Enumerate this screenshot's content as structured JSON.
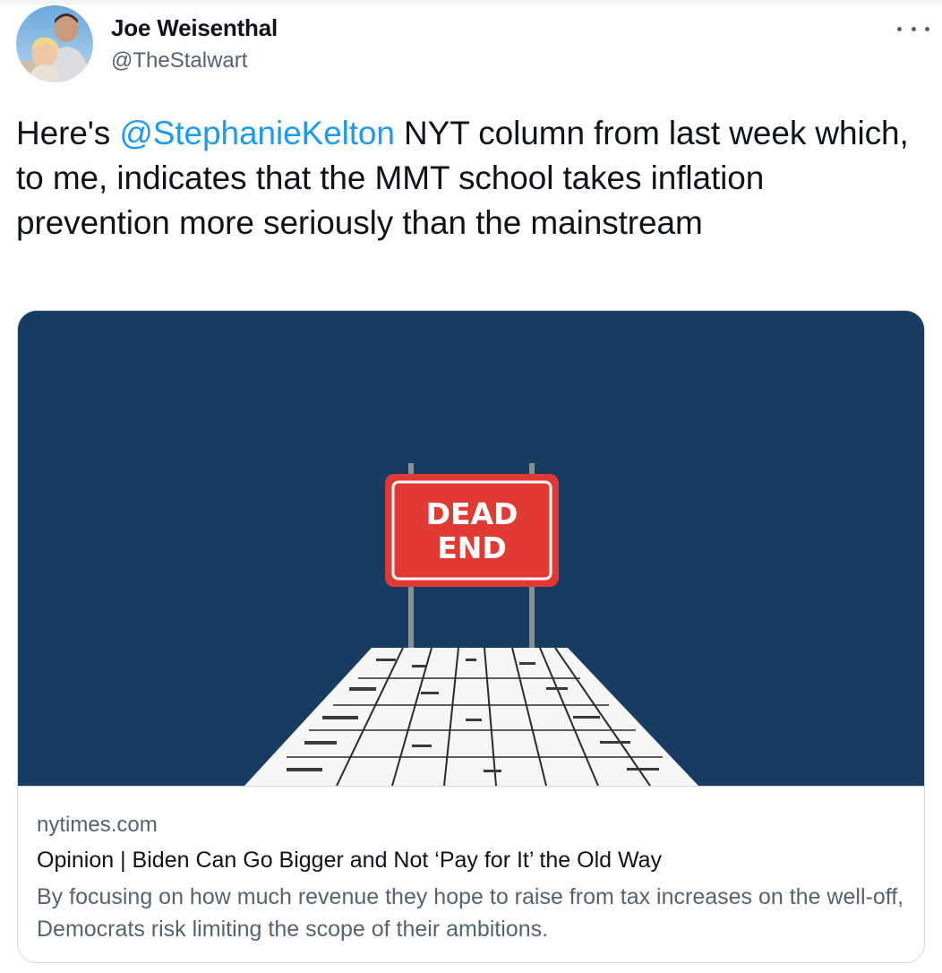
{
  "tweet": {
    "author": {
      "name": "Joe Weisenthal",
      "handle": "@TheStalwart"
    },
    "text": {
      "prefix": "Here's ",
      "mention": "@StephanieKelton",
      "suffix": " NYT column from last week which, to me, indicates that the MMT school takes inflation prevention more seriously than the mainstream"
    }
  },
  "card": {
    "image": {
      "sign_line1": "DEAD",
      "sign_line2": "END"
    },
    "domain": "nytimes.com",
    "title": "Opinion | Biden Can Go Bigger and Not ‘Pay for It’ the Old Way",
    "description": "By focusing on how much revenue they hope to raise from tax increases on the well-off, Democrats risk limiting the scope of their ambitions."
  },
  "icons": {
    "more": "more-horizontal-icon",
    "avatar": "avatar-photo"
  },
  "colors": {
    "link": "#1d9bf0",
    "secondary_text": "#536471",
    "card_background": "#173b61",
    "sign_red": "#e03a33"
  }
}
